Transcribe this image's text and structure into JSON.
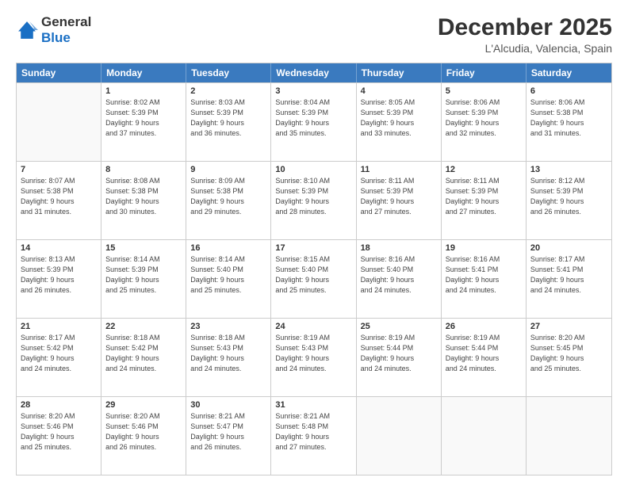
{
  "logo": {
    "line1": "General",
    "line2": "Blue"
  },
  "title": "December 2025",
  "location": "L'Alcudia, Valencia, Spain",
  "header_days": [
    "Sunday",
    "Monday",
    "Tuesday",
    "Wednesday",
    "Thursday",
    "Friday",
    "Saturday"
  ],
  "weeks": [
    [
      {
        "day": "",
        "info": ""
      },
      {
        "day": "1",
        "info": "Sunrise: 8:02 AM\nSunset: 5:39 PM\nDaylight: 9 hours\nand 37 minutes."
      },
      {
        "day": "2",
        "info": "Sunrise: 8:03 AM\nSunset: 5:39 PM\nDaylight: 9 hours\nand 36 minutes."
      },
      {
        "day": "3",
        "info": "Sunrise: 8:04 AM\nSunset: 5:39 PM\nDaylight: 9 hours\nand 35 minutes."
      },
      {
        "day": "4",
        "info": "Sunrise: 8:05 AM\nSunset: 5:39 PM\nDaylight: 9 hours\nand 33 minutes."
      },
      {
        "day": "5",
        "info": "Sunrise: 8:06 AM\nSunset: 5:39 PM\nDaylight: 9 hours\nand 32 minutes."
      },
      {
        "day": "6",
        "info": "Sunrise: 8:06 AM\nSunset: 5:38 PM\nDaylight: 9 hours\nand 31 minutes."
      }
    ],
    [
      {
        "day": "7",
        "info": "Sunrise: 8:07 AM\nSunset: 5:38 PM\nDaylight: 9 hours\nand 31 minutes."
      },
      {
        "day": "8",
        "info": "Sunrise: 8:08 AM\nSunset: 5:38 PM\nDaylight: 9 hours\nand 30 minutes."
      },
      {
        "day": "9",
        "info": "Sunrise: 8:09 AM\nSunset: 5:38 PM\nDaylight: 9 hours\nand 29 minutes."
      },
      {
        "day": "10",
        "info": "Sunrise: 8:10 AM\nSunset: 5:39 PM\nDaylight: 9 hours\nand 28 minutes."
      },
      {
        "day": "11",
        "info": "Sunrise: 8:11 AM\nSunset: 5:39 PM\nDaylight: 9 hours\nand 27 minutes."
      },
      {
        "day": "12",
        "info": "Sunrise: 8:11 AM\nSunset: 5:39 PM\nDaylight: 9 hours\nand 27 minutes."
      },
      {
        "day": "13",
        "info": "Sunrise: 8:12 AM\nSunset: 5:39 PM\nDaylight: 9 hours\nand 26 minutes."
      }
    ],
    [
      {
        "day": "14",
        "info": "Sunrise: 8:13 AM\nSunset: 5:39 PM\nDaylight: 9 hours\nand 26 minutes."
      },
      {
        "day": "15",
        "info": "Sunrise: 8:14 AM\nSunset: 5:39 PM\nDaylight: 9 hours\nand 25 minutes."
      },
      {
        "day": "16",
        "info": "Sunrise: 8:14 AM\nSunset: 5:40 PM\nDaylight: 9 hours\nand 25 minutes."
      },
      {
        "day": "17",
        "info": "Sunrise: 8:15 AM\nSunset: 5:40 PM\nDaylight: 9 hours\nand 25 minutes."
      },
      {
        "day": "18",
        "info": "Sunrise: 8:16 AM\nSunset: 5:40 PM\nDaylight: 9 hours\nand 24 minutes."
      },
      {
        "day": "19",
        "info": "Sunrise: 8:16 AM\nSunset: 5:41 PM\nDaylight: 9 hours\nand 24 minutes."
      },
      {
        "day": "20",
        "info": "Sunrise: 8:17 AM\nSunset: 5:41 PM\nDaylight: 9 hours\nand 24 minutes."
      }
    ],
    [
      {
        "day": "21",
        "info": "Sunrise: 8:17 AM\nSunset: 5:42 PM\nDaylight: 9 hours\nand 24 minutes."
      },
      {
        "day": "22",
        "info": "Sunrise: 8:18 AM\nSunset: 5:42 PM\nDaylight: 9 hours\nand 24 minutes."
      },
      {
        "day": "23",
        "info": "Sunrise: 8:18 AM\nSunset: 5:43 PM\nDaylight: 9 hours\nand 24 minutes."
      },
      {
        "day": "24",
        "info": "Sunrise: 8:19 AM\nSunset: 5:43 PM\nDaylight: 9 hours\nand 24 minutes."
      },
      {
        "day": "25",
        "info": "Sunrise: 8:19 AM\nSunset: 5:44 PM\nDaylight: 9 hours\nand 24 minutes."
      },
      {
        "day": "26",
        "info": "Sunrise: 8:19 AM\nSunset: 5:44 PM\nDaylight: 9 hours\nand 24 minutes."
      },
      {
        "day": "27",
        "info": "Sunrise: 8:20 AM\nSunset: 5:45 PM\nDaylight: 9 hours\nand 25 minutes."
      }
    ],
    [
      {
        "day": "28",
        "info": "Sunrise: 8:20 AM\nSunset: 5:46 PM\nDaylight: 9 hours\nand 25 minutes."
      },
      {
        "day": "29",
        "info": "Sunrise: 8:20 AM\nSunset: 5:46 PM\nDaylight: 9 hours\nand 26 minutes."
      },
      {
        "day": "30",
        "info": "Sunrise: 8:21 AM\nSunset: 5:47 PM\nDaylight: 9 hours\nand 26 minutes."
      },
      {
        "day": "31",
        "info": "Sunrise: 8:21 AM\nSunset: 5:48 PM\nDaylight: 9 hours\nand 27 minutes."
      },
      {
        "day": "",
        "info": ""
      },
      {
        "day": "",
        "info": ""
      },
      {
        "day": "",
        "info": ""
      }
    ]
  ]
}
